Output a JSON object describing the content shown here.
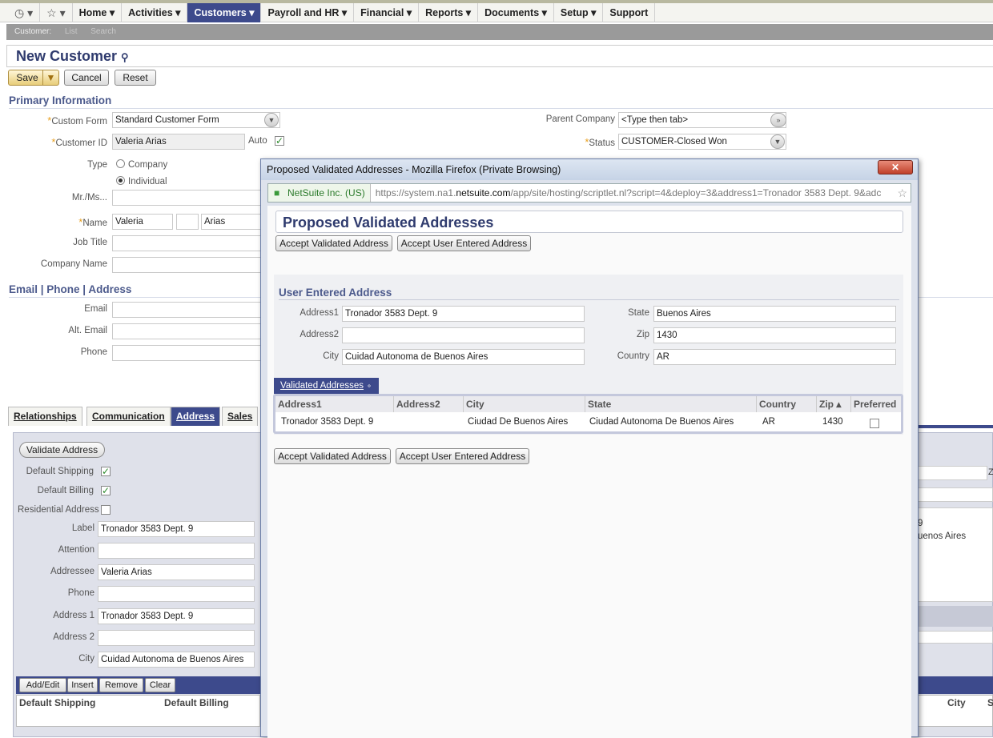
{
  "nav": {
    "items": [
      "Home",
      "Activities",
      "Customers",
      "Payroll and HR",
      "Financial",
      "Reports",
      "Documents",
      "Setup",
      "Support"
    ],
    "active": "Customers"
  },
  "subnav": {
    "label": "Customer:",
    "list": "List",
    "search": "Search"
  },
  "page": {
    "title": "New Customer"
  },
  "buttons": {
    "save": "Save",
    "cancel": "Cancel",
    "reset": "Reset"
  },
  "primary": {
    "section": "Primary Information",
    "custom_form_label": "Custom Form",
    "custom_form": "Standard Customer Form",
    "customer_id_label": "Customer ID",
    "customer_id": "Valeria Arias",
    "auto_label": "Auto",
    "type_label": "Type",
    "company_option": "Company",
    "individual_option": "Individual",
    "mr_label": "Mr./Ms...",
    "name_label": "Name",
    "first_name": "Valeria",
    "last_name": "Arias",
    "job_title_label": "Job Title",
    "company_name_label": "Company Name",
    "parent_company_label": "Parent Company",
    "parent_company_placeholder": "<Type then tab>",
    "status_label": "Status",
    "status": "CUSTOMER-Closed Won"
  },
  "contact": {
    "section": "Email | Phone | Address",
    "email_label": "Email",
    "alt_email_label": "Alt. Email",
    "phone_label": "Phone"
  },
  "tabs": [
    "Relationships",
    "Communication",
    "Address",
    "Sales"
  ],
  "address_form": {
    "validate_button": "Validate Address",
    "default_shipping_label": "Default Shipping",
    "default_billing_label": "Default Billing",
    "residential_label": "Residential Address",
    "label_label": "Label",
    "label": "Tronador 3583 Dept. 9",
    "attention_label": "Attention",
    "addressee_label": "Addressee",
    "addressee": "Valeria Arias",
    "phone_label": "Phone",
    "address1_label": "Address 1",
    "address1": "Tronador 3583 Dept. 9",
    "address2_label": "Address 2",
    "city_label": "City",
    "city": "Cuidad Autonoma de Buenos Aires",
    "right_text_1": "9",
    "right_text_2": "uenos Aires",
    "right_city_header": "City",
    "right_s_header": "S",
    "right_suffix": "Z"
  },
  "address_buttons": [
    "Add/Edit",
    "Insert",
    "Remove",
    "Clear"
  ],
  "address_grid": {
    "headers": [
      "Default Shipping",
      "Default Billing"
    ]
  },
  "popup": {
    "window_title": "Proposed Validated Addresses - Mozilla Firefox (Private Browsing)",
    "site": "NetSuite Inc. (US)",
    "url_prefix": "https://system.na1.",
    "url_domain": "netsuite.com",
    "url_suffix": "/app/site/hosting/scriptlet.nl?script=4&deploy=3&address1=Tronador 3583 Dept. 9&adc",
    "heading": "Proposed Validated Addresses",
    "accept_validated": "Accept Validated Address",
    "accept_user": "Accept User Entered Address",
    "user_section": "User Entered Address",
    "address1_label": "Address1",
    "address1": "Tronador 3583 Dept. 9",
    "address2_label": "Address2",
    "address2": "",
    "city_label": "City",
    "city": "Cuidad Autonoma de Buenos Aires",
    "state_label": "State",
    "state": "Buenos Aires",
    "zip_label": "Zip",
    "zip": "1430",
    "country_label": "Country",
    "country": "AR",
    "validated_tab": "Validated Addresses",
    "grid_headers": [
      "Address1",
      "Address2",
      "City",
      "State",
      "Country",
      "Zip ▴",
      "Preferred"
    ],
    "grid_row": [
      "Tronador 3583 Dept. 9",
      "",
      "Ciudad De Buenos Aires",
      "Ciudad Autonoma De Buenos Aires",
      "AR",
      "1430"
    ]
  }
}
